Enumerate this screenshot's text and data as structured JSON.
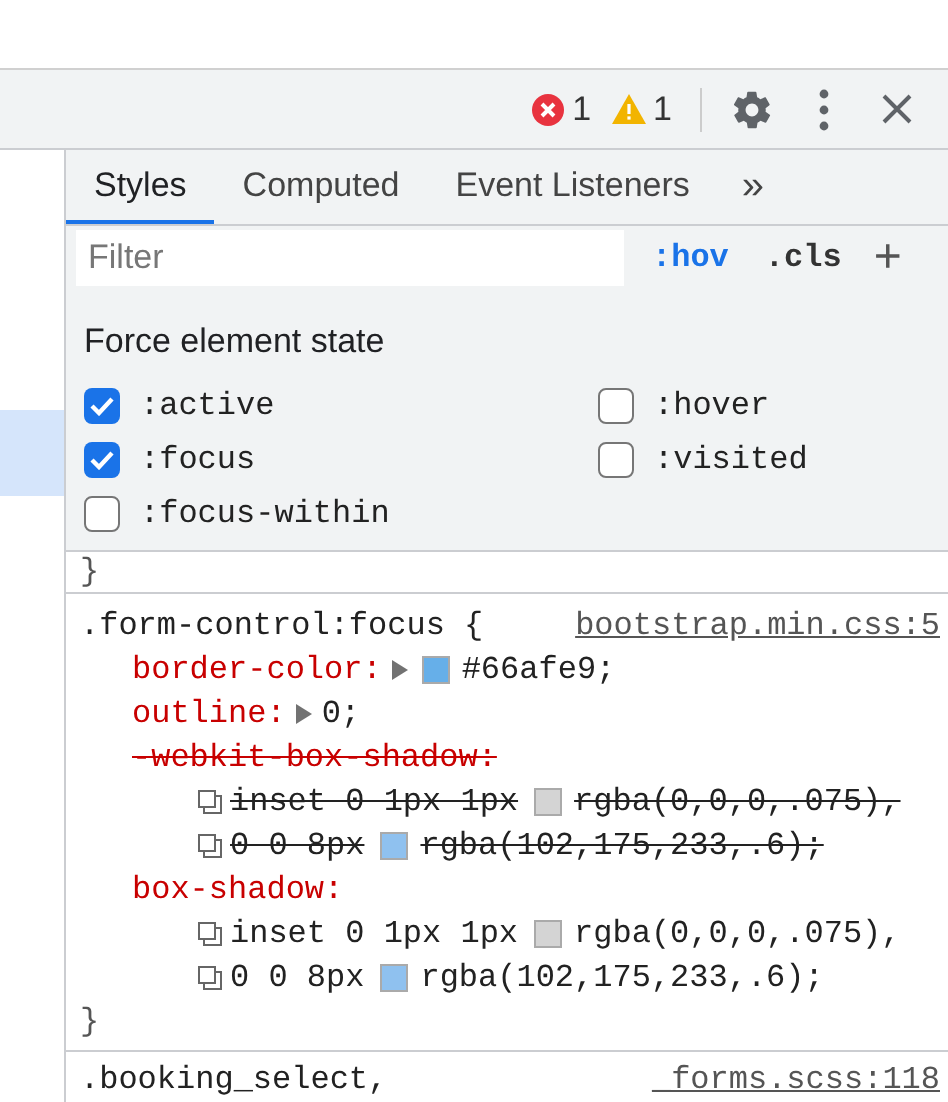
{
  "toolbar": {
    "errors": "1",
    "warnings": "1"
  },
  "tabs": [
    {
      "label": "Styles",
      "selected": true
    },
    {
      "label": "Computed",
      "selected": false
    },
    {
      "label": "Event Listeners",
      "selected": false
    }
  ],
  "more_tabs": "»",
  "filter": {
    "placeholder": "Filter",
    "hov": ":hov",
    "cls": ".cls",
    "add": "+"
  },
  "force_state": {
    "title": "Force element state",
    "states": [
      {
        "label": ":active",
        "checked": true
      },
      {
        "label": ":hover",
        "checked": false
      },
      {
        "label": ":focus",
        "checked": true
      },
      {
        "label": ":visited",
        "checked": false
      },
      {
        "label": ":focus-within",
        "checked": false
      }
    ]
  },
  "element_style_close": "}",
  "rule": {
    "selector": ".form-control:focus {",
    "source": "bootstrap.min.css:5",
    "declarations": [
      {
        "name": "border-color:",
        "struck": false,
        "expandable": true,
        "color": "#66afe9",
        "value": "#66afe9;"
      },
      {
        "name": "outline:",
        "struck": false,
        "expandable": true,
        "value": "0;"
      },
      {
        "name": "-webkit-box-shadow:",
        "struck": true,
        "lines": [
          {
            "text": "inset 0 1px 1px",
            "color": "#d4d4d4",
            "value": "rgba(0,0,0,.075),"
          },
          {
            "text": "0 0 8px",
            "color": "#8fc1ef",
            "value": "rgba(102,175,233,.6);"
          }
        ]
      },
      {
        "name": "box-shadow:",
        "struck": false,
        "lines": [
          {
            "text": "inset 0 1px 1px",
            "color": "#d4d4d4",
            "value": "rgba(0,0,0,.075),"
          },
          {
            "text": "0 0 8px",
            "color": "#8fc1ef",
            "value": "rgba(102,175,233,.6);"
          }
        ]
      }
    ],
    "close": "}"
  },
  "next_rule": {
    "selector": ".booking_select,",
    "source": "_forms.scss:118"
  }
}
